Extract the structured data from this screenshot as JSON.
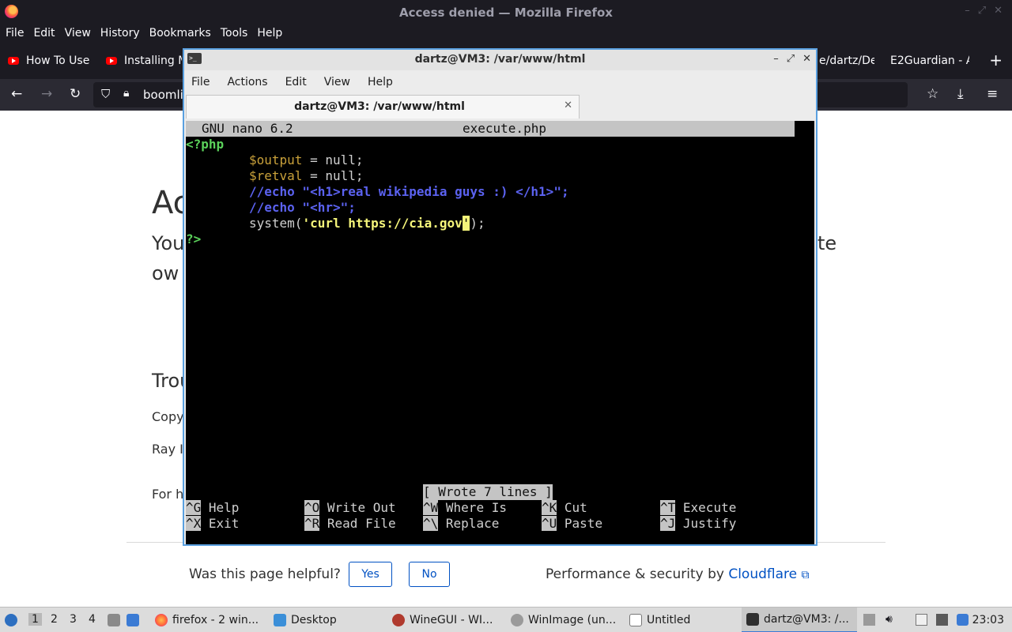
{
  "firefox": {
    "window_title": "Access denied — Mozilla Firefox",
    "menu": [
      "File",
      "Edit",
      "View",
      "History",
      "Bookmarks",
      "Tools",
      "Help"
    ],
    "tabs": [
      {
        "label": "How To Use"
      },
      {
        "label": "Installing M"
      },
      {
        "label": "e/dartz/De"
      },
      {
        "label": "E2Guardian - A"
      }
    ],
    "url_text": "boomli"
  },
  "page": {
    "heading_fragment": "Ac",
    "lead_line1_start": "You",
    "lead_line1_end": "te",
    "lead_line2_start": "ow",
    "troubleshoot_fragment": "Trou",
    "para1_fragment": "Copy",
    "para2_fragment": "Ray I",
    "para3_fragment": "For h",
    "helpful_question": "Was this page helpful?",
    "yes_label": "Yes",
    "no_label": "No",
    "perf_text": "Performance & security by ",
    "cloudflare_link": "Cloudflare"
  },
  "terminal": {
    "title": "dartz@VM3: /var/www/html",
    "menu": [
      "File",
      "Actions",
      "Edit",
      "View",
      "Help"
    ],
    "tab_title": "dartz@VM3: /var/www/html",
    "nano": {
      "app_version": "GNU nano 6.2",
      "filename": "execute.php",
      "lines": {
        "l1": "<?php",
        "l2_var": "$output",
        "l2_rest": " = null;",
        "l3_var": "$retval",
        "l3_rest": " = null;",
        "l4": "//echo \"<h1>real wikipedia guys :) </h1>\";",
        "l5": "//echo \"<hr>\";",
        "l6_fn": "system(",
        "l6_str": "'curl https://cia.gov",
        "l6_cursor": "'",
        "l6_end": ");",
        "l7": "?>"
      },
      "status": "[ Wrote 7 lines ]",
      "shortcuts": [
        {
          "key": "^G",
          "label": "Help"
        },
        {
          "key": "^O",
          "label": "Write Out"
        },
        {
          "key": "^W",
          "label": "Where Is"
        },
        {
          "key": "^K",
          "label": "Cut"
        },
        {
          "key": "^T",
          "label": "Execute"
        },
        {
          "key": "^X",
          "label": "Exit"
        },
        {
          "key": "^R",
          "label": "Read File"
        },
        {
          "key": "^\\",
          "label": "Replace"
        },
        {
          "key": "^U",
          "label": "Paste"
        },
        {
          "key": "^J",
          "label": "Justify"
        }
      ]
    }
  },
  "taskbar": {
    "workspaces": [
      "1",
      "2",
      "3",
      "4"
    ],
    "items": [
      {
        "label": "firefox - 2 win..."
      },
      {
        "label": "Desktop"
      },
      {
        "label": "WineGUI - WI..."
      },
      {
        "label": "WinImage (un..."
      },
      {
        "label": "Untitled"
      },
      {
        "label": "dartz@VM3: /..."
      }
    ],
    "clock": "23:03"
  },
  "colors": {
    "php_keyword": "#5bd15b",
    "php_variable": "#c9a13a",
    "php_comment": "#5b62f0",
    "php_string": "#f6f67a",
    "cloudflare_blue": "#0051c3"
  }
}
